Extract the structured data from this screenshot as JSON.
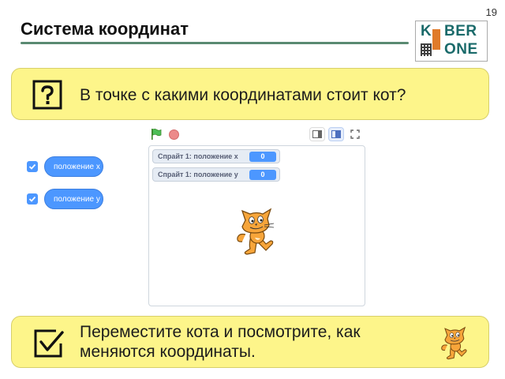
{
  "slide": {
    "number": "19",
    "title": "Система координат"
  },
  "logo": {
    "line1_k": "K",
    "line1_ber": "BER",
    "line2": "ONE"
  },
  "task": {
    "question": "В точке с какими координатами стоит кот?",
    "instruction_line1": "Переместите кота и посмотрите, как",
    "instruction_line2": "меняются координаты."
  },
  "blocks": [
    {
      "label": "положение x",
      "checked": true
    },
    {
      "label": "положение y",
      "checked": true
    }
  ],
  "stage": {
    "monitors": [
      {
        "label": "Спрайт 1: положение x",
        "value": "0"
      },
      {
        "label": "Спрайт 1: положение y",
        "value": "0"
      }
    ],
    "icons": [
      "green-flag-icon",
      "stop-icon",
      "small-stage-icon",
      "normal-stage-icon",
      "fullscreen-icon"
    ]
  },
  "colors": {
    "banner_bg": "#fdf58a",
    "block_blue": "#4c97ff",
    "title_rule": "#5a8a72",
    "cat_orange": "#f7a53a"
  }
}
